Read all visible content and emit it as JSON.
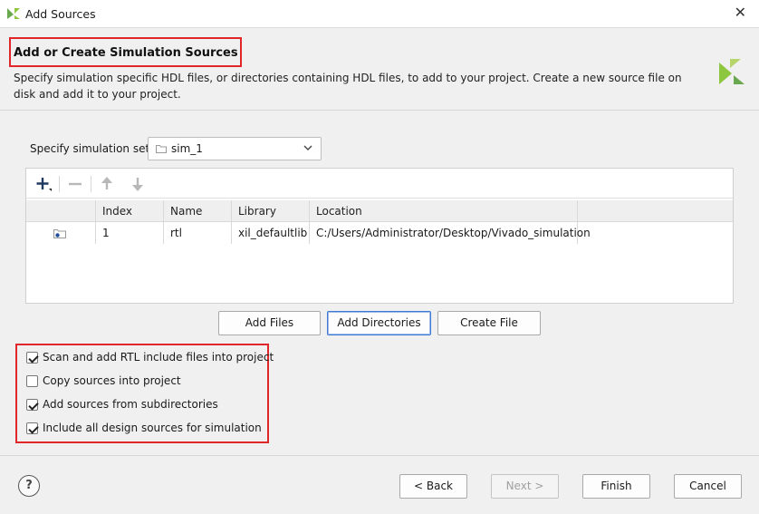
{
  "window": {
    "title": "Add Sources",
    "close_glyph": "✕"
  },
  "header": {
    "heading": "Add or Create Simulation Sources",
    "description": "Specify simulation specific HDL files, or directories containing HDL files, to add to your project. Create a new source file on disk and add it to your project."
  },
  "simulation_set": {
    "label": "Specify simulation set:",
    "value": "sim_1"
  },
  "table": {
    "toolbar": [
      "add-icon",
      "remove-icon",
      "move-up-icon",
      "move-down-icon"
    ],
    "columns": [
      "Index",
      "Name",
      "Library",
      "Location"
    ],
    "rows": [
      {
        "index": "1",
        "name": "rtl",
        "library": "xil_defaultlib",
        "location": "C:/Users/Administrator/Desktop/Vivado_simulation"
      }
    ]
  },
  "actions": {
    "add_files": "Add Files",
    "add_directories": "Add Directories",
    "create_file": "Create File"
  },
  "options": [
    {
      "label": "Scan and add RTL include files into project",
      "checked": true
    },
    {
      "label": "Copy sources into project",
      "checked": false
    },
    {
      "label": "Add sources from subdirectories",
      "checked": true
    },
    {
      "label": "Include all design sources for simulation",
      "checked": true
    }
  ],
  "footer": {
    "help": "?",
    "back": "< Back",
    "next": "Next >",
    "finish": "Finish",
    "cancel": "Cancel"
  },
  "colors": {
    "highlight": "#e0262a",
    "focus": "#3d7ad6",
    "logo_green": "#8dc63f"
  }
}
